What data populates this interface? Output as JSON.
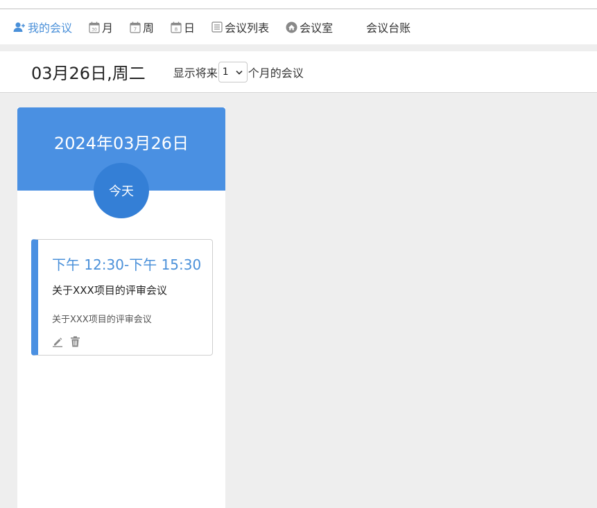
{
  "nav": {
    "items": [
      {
        "label": "我的会议",
        "icon": "user-icon"
      },
      {
        "label": "月",
        "icon": "calendar-month-icon",
        "glyph": "30"
      },
      {
        "label": "周",
        "icon": "calendar-week-icon",
        "glyph": "7"
      },
      {
        "label": "日",
        "icon": "calendar-day-icon",
        "glyph": "8"
      },
      {
        "label": "会议列表",
        "icon": "list-icon"
      },
      {
        "label": "会议室",
        "icon": "home-icon"
      },
      {
        "label": "会议台账"
      }
    ],
    "active_color": "#4a90d9"
  },
  "datebar": {
    "title": "03月26日,周二",
    "range_prefix": "显示将来",
    "range_value": "1",
    "range_suffix": "个月的会议"
  },
  "day": {
    "date": "2024年03月26日",
    "today_label": "今天",
    "header_color": "#4a90e2",
    "badge_color": "#347fd6"
  },
  "meeting": {
    "time": "下午 12:30-下午 15:30",
    "title": "关于XXX项目的评审会议",
    "description": "关于XXX项目的评审会议",
    "actions": [
      "edit-icon",
      "trash-icon"
    ]
  }
}
